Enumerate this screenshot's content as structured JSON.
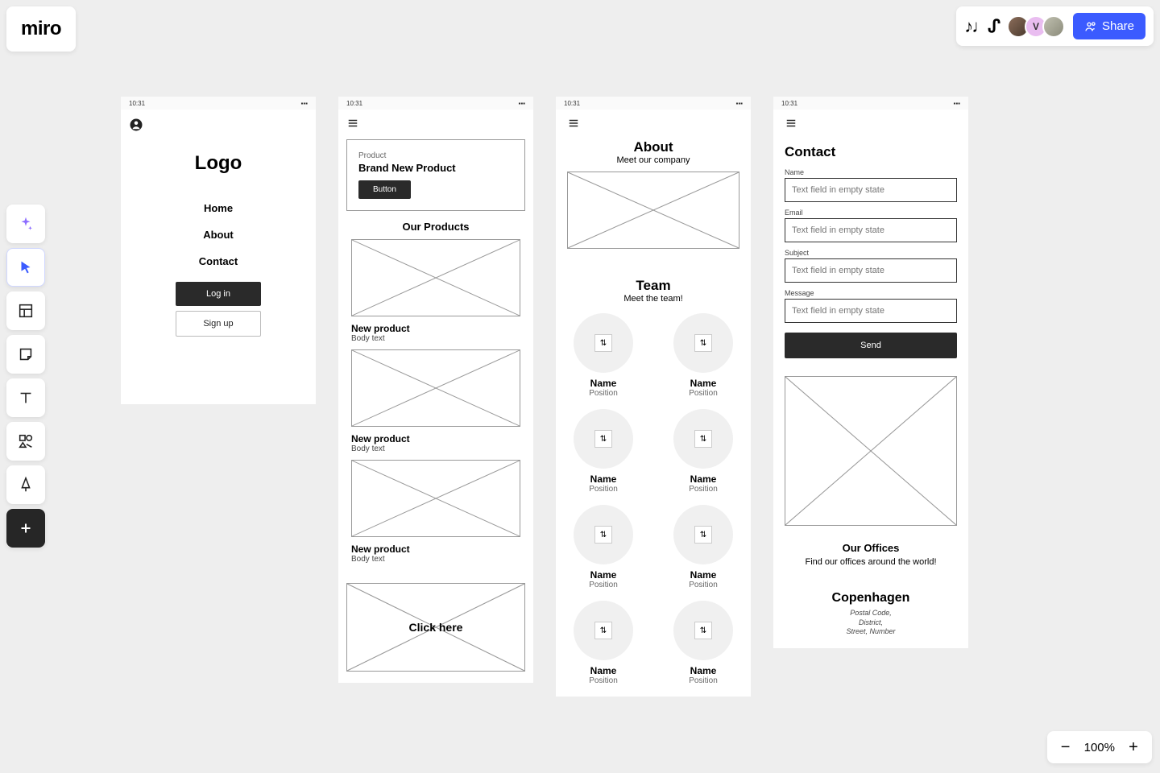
{
  "app": {
    "logo": "miro"
  },
  "header": {
    "avatar2_initial": "V",
    "share_label": "Share"
  },
  "toolbar": {
    "items": [
      "ai",
      "cursor",
      "frame",
      "sticky",
      "text",
      "shapes",
      "pen",
      "more"
    ]
  },
  "zoom": {
    "level": "100%"
  },
  "status_time": "10:31",
  "frame1": {
    "logo": "Logo",
    "nav": [
      "Home",
      "About",
      "Contact"
    ],
    "login": "Log in",
    "signup": "Sign up"
  },
  "frame2": {
    "promo_eyebrow": "Product",
    "promo_headline": "Brand New Product",
    "promo_button": "Button",
    "section": "Our Products",
    "products": [
      {
        "title": "New product",
        "body": "Body text"
      },
      {
        "title": "New product",
        "body": "Body text"
      },
      {
        "title": "New product",
        "body": "Body text"
      }
    ],
    "click_here": "Click here"
  },
  "frame3": {
    "about_title": "About",
    "about_sub": "Meet our company",
    "team_title": "Team",
    "team_sub": "Meet the team!",
    "members": [
      {
        "name": "Name",
        "position": "Position"
      },
      {
        "name": "Name",
        "position": "Position"
      },
      {
        "name": "Name",
        "position": "Position"
      },
      {
        "name": "Name",
        "position": "Position"
      },
      {
        "name": "Name",
        "position": "Position"
      },
      {
        "name": "Name",
        "position": "Position"
      },
      {
        "name": "Name",
        "position": "Position"
      },
      {
        "name": "Name",
        "position": "Position"
      }
    ]
  },
  "frame4": {
    "title": "Contact",
    "fields": {
      "name_label": "Name",
      "email_label": "Email",
      "subject_label": "Subject",
      "message_label": "Message",
      "placeholder": "Text field in empty state"
    },
    "send": "Send",
    "offices_title": "Our Offices",
    "offices_sub": "Find our offices around the world!",
    "city": "Copenhagen",
    "addr1": "Postal Code,",
    "addr2": "District,",
    "addr3": "Street, Number"
  }
}
